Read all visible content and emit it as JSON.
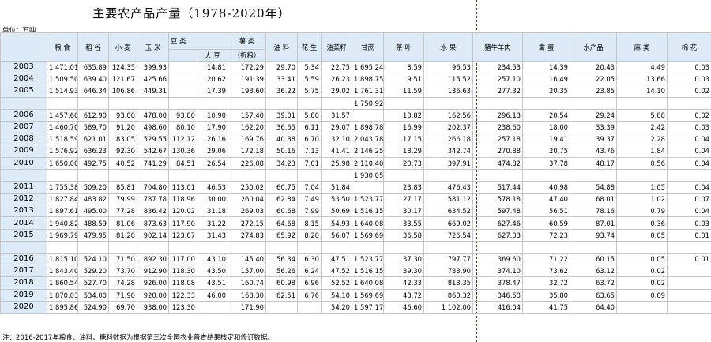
{
  "title": "主要农产品产量（1978-2020年）",
  "unit": "单位：万吨",
  "note": "注：2016-2017年粮食、油料、糖料数据为根据第三次全国农业普查结果核定和修订数据。",
  "headers": [
    "粮 食",
    "稻 谷",
    "小 麦",
    "玉 米",
    "豆 类",
    "",
    "薯 类",
    "油 料",
    "花 生",
    "油菜籽",
    "甘蔗",
    "茶 叶",
    "水 果",
    "猪牛羊肉",
    "禽 蛋",
    "水产品",
    "麻 类",
    "棉 花"
  ],
  "sub_headers": [
    "大 豆",
    "（折粮）"
  ],
  "rows": [
    [
      "2003",
      "1 471.01",
      "635.89",
      "124.35",
      "399.93",
      "",
      "14.81",
      "172.29",
      "29.70",
      "5.34",
      "22.75",
      "1 695.24",
      "8.59",
      "96.53",
      "234.53",
      "14.39",
      "20.43",
      "4.49",
      "0.03"
    ],
    [
      "2004",
      "1 509.50",
      "639.40",
      "121.67",
      "425.66",
      "",
      "20.62",
      "191.39",
      "33.41",
      "5.59",
      "26.23",
      "1 898.75",
      "9.51",
      "115.52",
      "257.10",
      "16.49",
      "22.05",
      "13.66",
      "0.03"
    ],
    [
      "2005",
      "1 514.93",
      "646.34",
      "106.86",
      "449.31",
      "",
      "17.39",
      "193.60",
      "36.22",
      "5.75",
      "29.02",
      "1 761.31",
      "11.59",
      "136.63",
      "277.32",
      "20.35",
      "23.85",
      "14.10",
      "0.02"
    ],
    [
      "",
      "",
      "",
      "",
      "",
      "",
      "",
      "",
      "",
      "",
      "",
      "1 750.92",
      "",
      "",
      "",
      "",
      "",
      "",
      ""
    ],
    [
      "2006",
      "1 457.60",
      "612.90",
      "93.00",
      "478.00",
      "93.80",
      "10.90",
      "157.40",
      "39.01",
      "5.80",
      "31.57",
      "",
      "13.82",
      "162.56",
      "296.13",
      "20.54",
      "29.24",
      "5.88",
      "0.02"
    ],
    [
      "2007",
      "1 460.70",
      "589.70",
      "91.20",
      "498.60",
      "80.10",
      "17.90",
      "162.20",
      "36.65",
      "6.11",
      "29.07",
      "1 898.78",
      "16.99",
      "202.37",
      "238.60",
      "18.00",
      "33.39",
      "2.42",
      "0.03"
    ],
    [
      "2008",
      "1 518.59",
      "621.01",
      "83.05",
      "529.55",
      "112.12",
      "26.16",
      "169.76",
      "40.38",
      "6.70",
      "32.10",
      "2 043.78",
      "17.15",
      "266.18",
      "257.18",
      "19.41",
      "39.37",
      "2.28",
      "0.04"
    ],
    [
      "2009",
      "1 576.92",
      "636.23",
      "92.30",
      "542.67",
      "130.36",
      "29.06",
      "172.18",
      "50.16",
      "7.13",
      "41.41",
      "2 146.25",
      "18.29",
      "342.74",
      "270.88",
      "20.75",
      "43.76",
      "1.84",
      "0.04"
    ],
    [
      "2010",
      "1 650.00",
      "492.75",
      "40.52",
      "741.29",
      "84.51",
      "26.54",
      "226.08",
      "34.23",
      "7.01",
      "25.98",
      "2 110.40",
      "20.73",
      "397.91",
      "474.82",
      "37.78",
      "48.17",
      "0.56",
      "0.04"
    ],
    [
      "",
      "",
      "",
      "",
      "",
      "",
      "",
      "",
      "",
      "",
      "",
      "1 930.05",
      "",
      "",
      "",
      "",
      "",
      "",
      ""
    ],
    [
      "2011",
      "1 755.38",
      "509.20",
      "85.81",
      "704.80",
      "113.01",
      "46.53",
      "250.02",
      "60.75",
      "7.04",
      "51.84",
      "",
      "23.83",
      "476.43",
      "517.44",
      "40.98",
      "54.88",
      "1.05",
      "0.04"
    ],
    [
      "2012",
      "1 827.84",
      "483.82",
      "79.99",
      "787.78",
      "118.96",
      "30.00",
      "260.04",
      "62.84",
      "7.49",
      "53.50",
      "1 523.77",
      "27.17",
      "581.12",
      "578.18",
      "47.40",
      "68.01",
      "1.02",
      "0.07"
    ],
    [
      "2013",
      "1 897.61",
      "495.00",
      "77.28",
      "836.42",
      "120.02",
      "31.18",
      "269.03",
      "60.68",
      "7.99",
      "50.69",
      "1 516.15",
      "30.17",
      "634.52",
      "597.48",
      "56.51",
      "78.16",
      "0.79",
      "0.04"
    ],
    [
      "2014",
      "1 940.82",
      "488.59",
      "81.06",
      "873.63",
      "117.90",
      "31.22",
      "272.15",
      "64.68",
      "8.15",
      "54.93",
      "1 640.08",
      "33.55",
      "669.02",
      "627.46",
      "60.59",
      "87.01",
      "0.36",
      "0.03"
    ],
    [
      "2015",
      "1 969.79",
      "479.95",
      "81.20",
      "902.14",
      "123.07",
      "31.43",
      "274.83",
      "65.92",
      "8.20",
      "56.07",
      "1 569.69",
      "36.58",
      "726.54",
      "627.03",
      "72.23",
      "93.74",
      "0.05",
      "0.01"
    ],
    [
      "",
      "",
      "",
      "",
      "",
      "",
      "",
      "",
      "",
      "",
      "",
      "",
      "",
      "",
      "",
      "",
      "",
      "",
      ""
    ],
    [
      "2016",
      "1 815.10",
      "524.10",
      "71.50",
      "892.30",
      "117.00",
      "43.10",
      "145.40",
      "56.34",
      "6.30",
      "47.51",
      "1 523.77",
      "37.30",
      "797.77",
      "369.60",
      "71.22",
      "60.15",
      "0.05",
      "0.01"
    ],
    [
      "2017",
      "1 843.40",
      "529.20",
      "73.70",
      "912.90",
      "118.30",
      "43.50",
      "157.00",
      "56.26",
      "6.24",
      "47.52",
      "1 516.15",
      "39.30",
      "783.90",
      "374.10",
      "73.62",
      "63.12",
      "0.02",
      ""
    ],
    [
      "2018",
      "1 860.54",
      "527.70",
      "74.28",
      "926.00",
      "118.08",
      "43.51",
      "160.74",
      "60.98",
      "6.96",
      "52.52",
      "1 640.08",
      "42.33",
      "813.35",
      "378.47",
      "32.72",
      "63.72",
      "0.02",
      ""
    ],
    [
      "2019",
      "1 870.03",
      "534.00",
      "71.90",
      "920.00",
      "122.33",
      "46.00",
      "168.30",
      "62.51",
      "6.76",
      "54.10",
      "1 569.69",
      "43.72",
      "860.32",
      "346.58",
      "35.80",
      "63.65",
      "0.09",
      ""
    ],
    [
      "2020",
      "1 895.86",
      "524.90",
      "69.70",
      "938.00",
      "123.30",
      "",
      "171.90",
      "",
      "",
      "54.20",
      "1 597.17",
      "46.60",
      "1 102.00",
      "416.04",
      "41.75",
      "64.40",
      "",
      ""
    ]
  ]
}
